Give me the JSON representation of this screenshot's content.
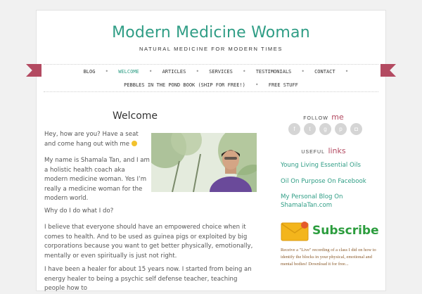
{
  "header": {
    "site_title": "Modern Medicine Woman",
    "tagline": "NATURAL MEDICINE FOR MODERN TIMES"
  },
  "nav": {
    "row1": [
      "BLOG",
      "WELCOME",
      "ARTICLES",
      "SERVICES",
      "TESTIMONIALS",
      "CONTACT"
    ],
    "row2": [
      "PEBBLES IN THE POND BOOK (SHIP FOR FREE!)",
      "FREE STUFF"
    ],
    "active": "WELCOME"
  },
  "main": {
    "title": "Welcome",
    "intro": "Hey, how are you? Have a seat and come hang out with me",
    "para2": "My name is Shamala Tan, and I am a holistic health coach aka modern medicine woman. Yes I’m really a medicine woman for the modern world.",
    "para3": "Why do I do what I do?",
    "para4": "I believe that everyone should have an empowered choice when it comes to health. And to be used as guinea pigs or exploited by big corporations because you want to get better physically, emotionally, mentally or even spiritually is just not right.",
    "para5": "I have been a healer for about 15 years now. I started from being an energy healer to being a psychic self defense teacher, teaching people how to"
  },
  "sidebar": {
    "follow": {
      "small": "FOLLOW",
      "big": "me"
    },
    "social_icons": [
      "facebook-icon",
      "twitter-icon",
      "google-plus-icon",
      "pinterest-icon",
      "instagram-icon"
    ],
    "useful": {
      "small": "USEFUL",
      "big": "links"
    },
    "links": [
      "Young Living Essential Oils",
      "Oil On Purpose On Facebook",
      "My Personal Blog On ShamalaTan.com"
    ],
    "subscribe": "Subscribe",
    "promo": "Receive a \"Live\" recording of a class I did on how to identify the blocks in your physical, emotional and mental bodies! Download it for free..."
  },
  "colors": {
    "accent": "#2f9d85",
    "ribbon": "#b34a61",
    "subscribe": "#2c9d3e"
  }
}
